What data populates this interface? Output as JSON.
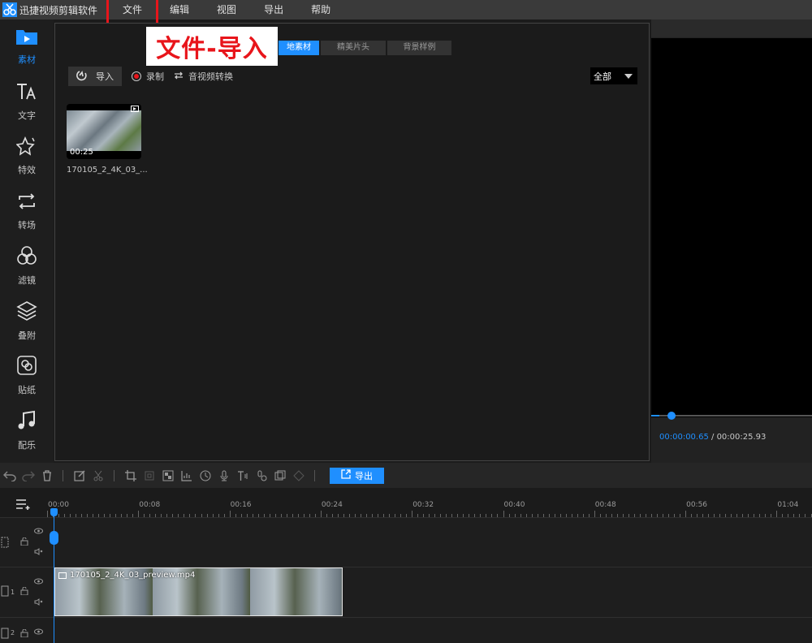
{
  "app": {
    "title": "迅捷视频剪辑软件"
  },
  "menu": [
    "文件",
    "编辑",
    "视图",
    "导出",
    "帮助"
  ],
  "callout": "文件-导入",
  "sidebar": [
    {
      "label": "素材",
      "icon": "media-icon",
      "active": true
    },
    {
      "label": "文字",
      "icon": "text-icon"
    },
    {
      "label": "特效",
      "icon": "effects-icon"
    },
    {
      "label": "转场",
      "icon": "transition-icon"
    },
    {
      "label": "滤镜",
      "icon": "filter-icon"
    },
    {
      "label": "叠附",
      "icon": "overlay-icon"
    },
    {
      "label": "贴纸",
      "icon": "sticker-icon"
    },
    {
      "label": "配乐",
      "icon": "music-icon"
    }
  ],
  "library": {
    "tabs": [
      "地素材",
      "精美片头",
      "背景样例"
    ],
    "import_label": "导入",
    "record_label": "录制",
    "convert_label": "音视频转换",
    "filter_value": "全部",
    "clip": {
      "duration": "00:25",
      "name": "170105_2_4K_03_..."
    }
  },
  "preview": {
    "current_time": "00:00:00.65",
    "separator": " / ",
    "total_time": "00:00:25.93",
    "progress": 0.025
  },
  "toolbar": {
    "export_label": "导出"
  },
  "ruler": [
    "00:00",
    "00:08",
    "00:16",
    "00:24",
    "00:32",
    "00:40",
    "00:48",
    "00:56",
    "01:04"
  ],
  "tracks": {
    "video_clip_name": "170105_2_4K_03_preview.mp4",
    "track1_num": "1",
    "track2_num": "2"
  }
}
